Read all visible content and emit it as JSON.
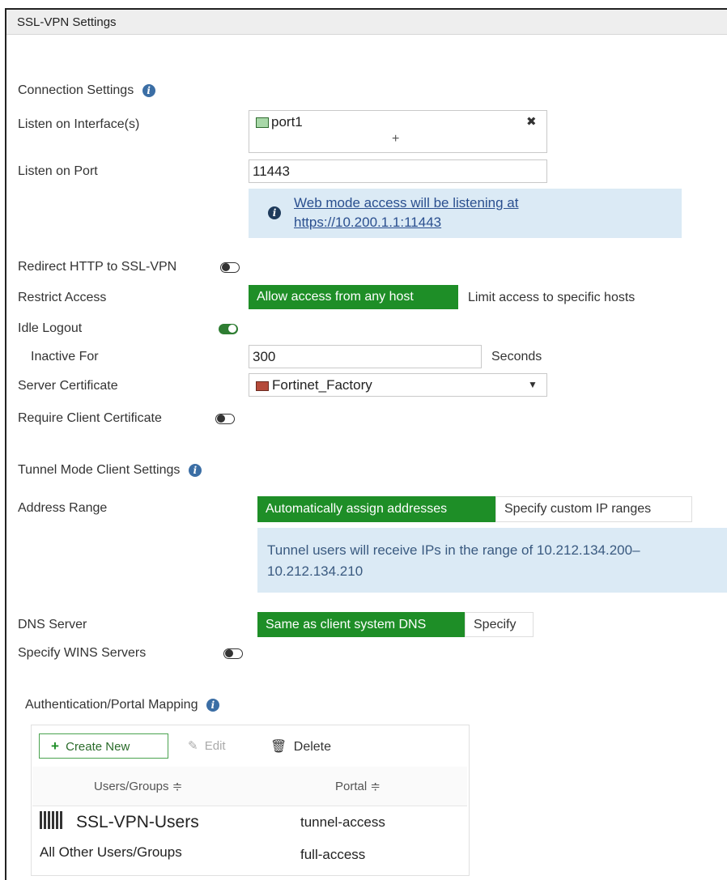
{
  "title": "SSL-VPN Settings",
  "connection": {
    "heading": "Connection Settings",
    "listen_interface_label": "Listen on Interface(s)",
    "interface_value": "port1",
    "add_symbol": "+",
    "remove_symbol": "✖",
    "listen_port_label": "Listen on Port",
    "port_value": "11443",
    "web_mode_note_line1": "Web mode access will be listening at",
    "web_mode_note_line2": "https://10.200.1.1:11443",
    "redirect_label": "Redirect HTTP to SSL-VPN",
    "redirect_enabled": false,
    "restrict_label": "Restrict Access",
    "restrict_options": [
      "Allow access from any host",
      "Limit access to specific hosts"
    ],
    "restrict_selected": "Allow access from any host",
    "idle_logout_label": "Idle Logout",
    "idle_logout_enabled": true,
    "inactive_label": "Inactive For",
    "inactive_value": "300",
    "inactive_unit": "Seconds",
    "server_cert_label": "Server Certificate",
    "server_cert_value": "Fortinet_Factory",
    "require_client_cert_label": "Require Client Certificate",
    "require_client_cert_enabled": false
  },
  "tunnel": {
    "heading": "Tunnel Mode Client Settings",
    "address_range_label": "Address Range",
    "address_options": [
      "Automatically assign addresses",
      "Specify custom IP ranges"
    ],
    "address_selected": "Automatically assign addresses",
    "address_note_line1": "Tunnel users will receive IPs in the range of 10.212.134.200–",
    "address_note_line2": "10.212.134.210",
    "dns_label": "DNS Server",
    "dns_options": [
      "Same as client system DNS",
      "Specify"
    ],
    "dns_selected": "Same as client system DNS",
    "wins_label": "Specify WINS Servers",
    "wins_enabled": false
  },
  "auth": {
    "heading": "Authentication/Portal Mapping",
    "create_new": "Create New",
    "edit": "Edit",
    "delete": "Delete",
    "columns": [
      "Users/Groups ≑",
      "Portal ≑"
    ],
    "rows": [
      {
        "users": "SSL-VPN-Users",
        "portal": "tunnel-access"
      },
      {
        "users": "All Other Users/Groups",
        "portal": "full-access"
      }
    ]
  },
  "colors": {
    "accent_green": "#1e8e27",
    "info_blue": "#3b6ea5",
    "note_bg": "#dbeaf5",
    "link": "#2a4f8f"
  }
}
